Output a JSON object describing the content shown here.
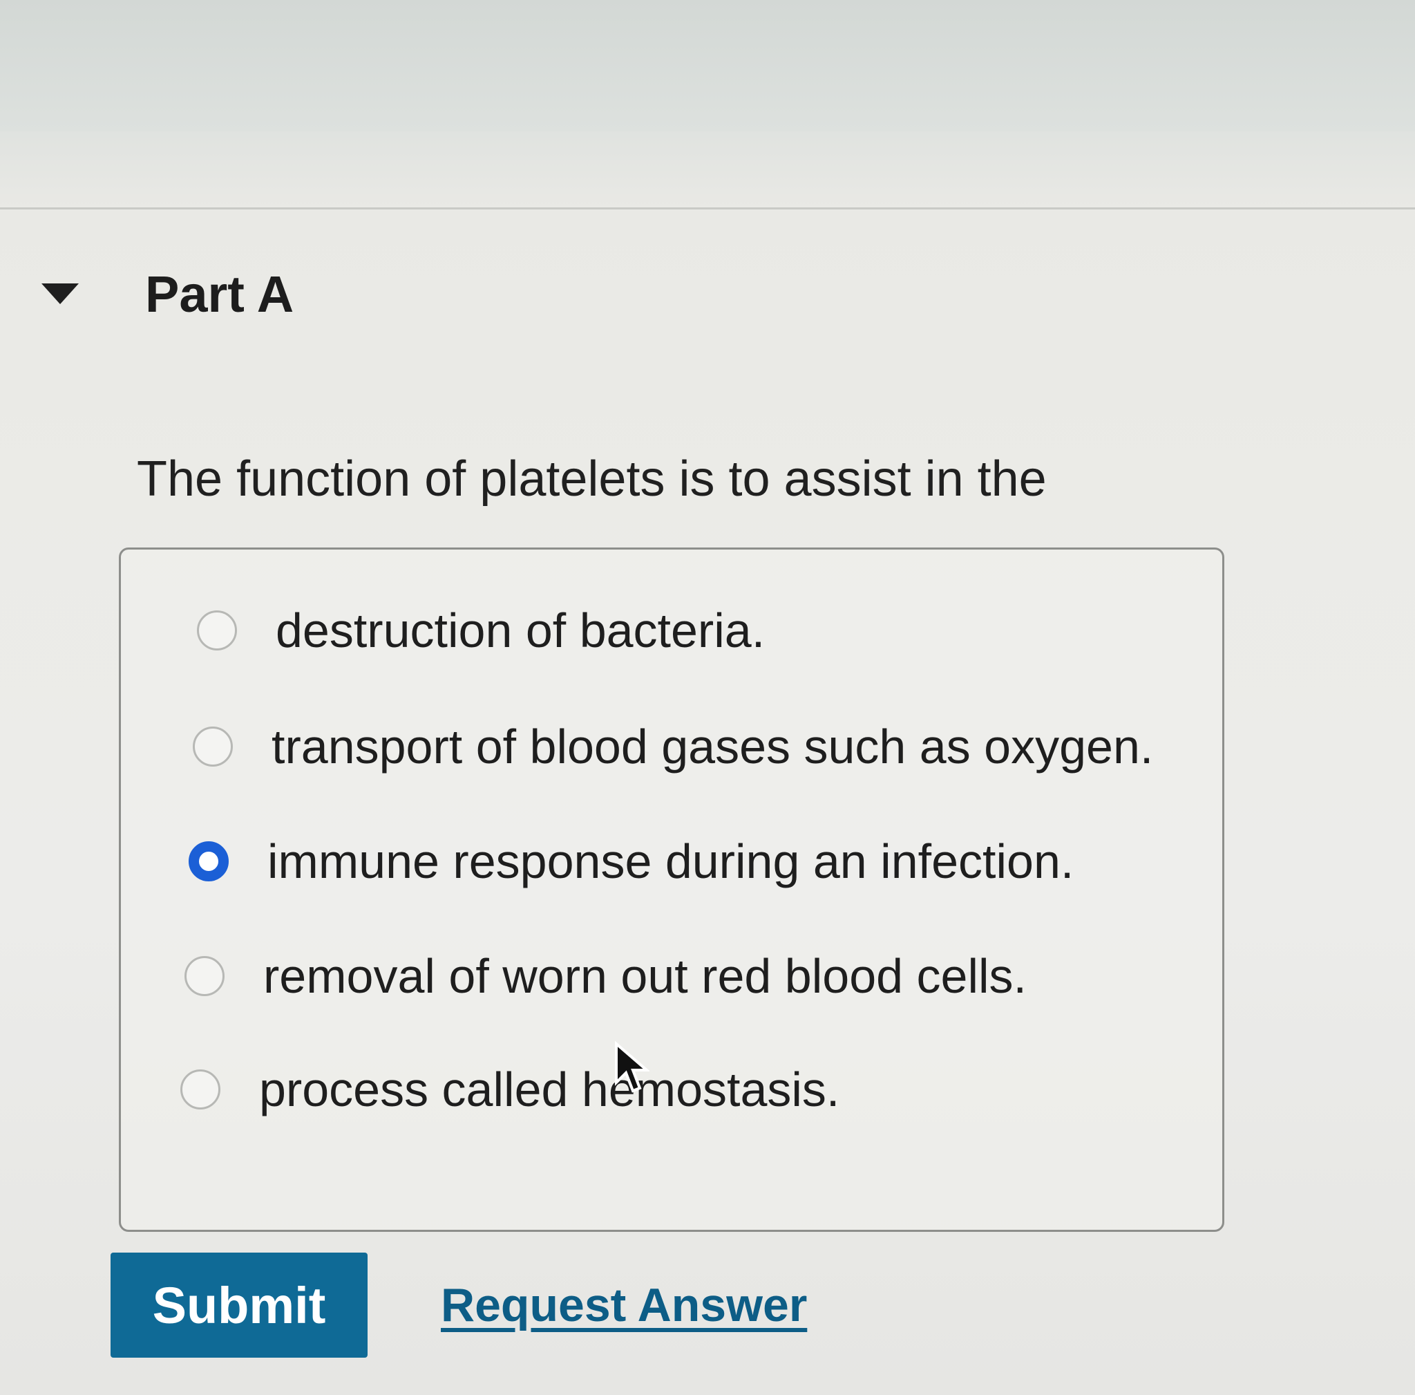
{
  "part": {
    "title": "Part A",
    "expanded": true
  },
  "question": {
    "prompt": "The function of platelets is to assist in the",
    "options": [
      {
        "label": "destruction of bacteria.",
        "selected": false
      },
      {
        "label": "transport of blood gases such as oxygen.",
        "selected": false
      },
      {
        "label": "immune response during an infection.",
        "selected": true
      },
      {
        "label": "removal of worn out red blood cells.",
        "selected": false
      },
      {
        "label": "process called hemostasis.",
        "selected": false
      }
    ]
  },
  "actions": {
    "submit_label": "Submit",
    "request_answer_label": "Request Answer"
  },
  "colors": {
    "accent_blue": "#1b5fd6",
    "submit_bg": "#0f6a96",
    "link": "#0d5d86"
  },
  "icons": {
    "collapse": "caret-down-icon",
    "pointer": "mouse-pointer-icon"
  }
}
